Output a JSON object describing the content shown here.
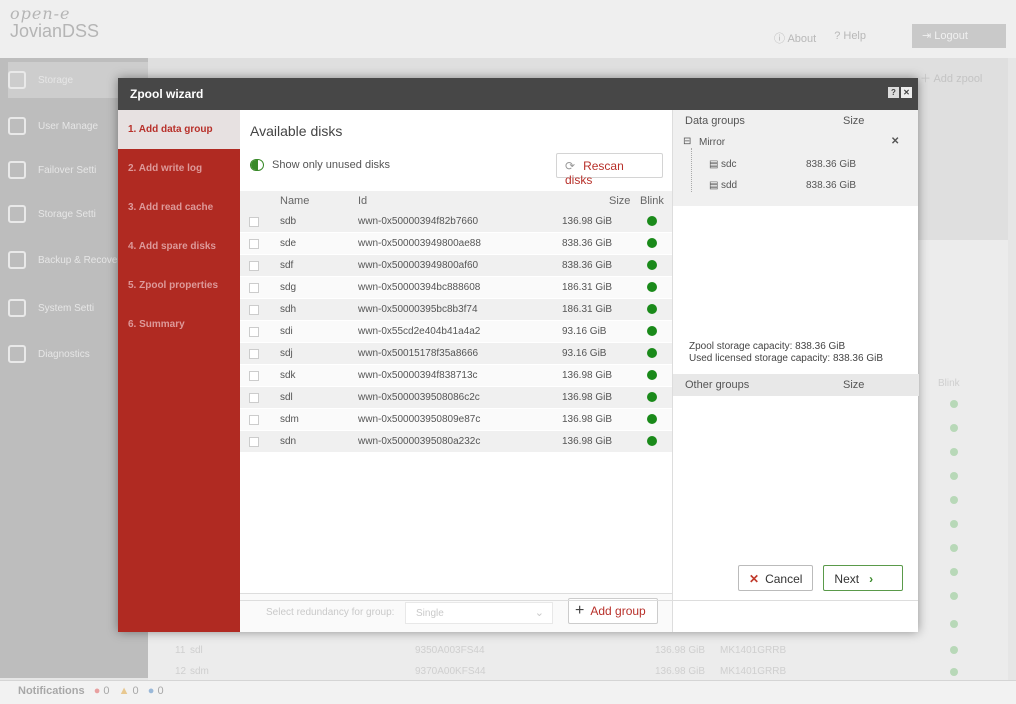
{
  "app": {
    "logo_top": "open-e",
    "logo_bottom": "JovianDSS",
    "about": "About",
    "help": "Help",
    "logout": "Logout",
    "add_zpool": "Add zpool"
  },
  "bg_nav": [
    "Storage",
    "User Manage",
    "Failover Setti",
    "Storage Setti",
    "Backup & Recovery",
    "System Setti",
    "Diagnostics"
  ],
  "bg_rows": {
    "blink_header": "Blink",
    "r11": [
      "11",
      "sdl",
      "9350A003FS44",
      "136.98 GiB",
      "MK1401GRRB"
    ],
    "r12": [
      "12",
      "sdm",
      "9370A00KFS44",
      "136.98 GiB",
      "MK1401GRRB"
    ]
  },
  "notifications": {
    "label": "Notifications",
    "errors": "0",
    "warnings": "0",
    "info": "0"
  },
  "dialog": {
    "title": "Zpool wizard",
    "steps": [
      "1. Add data group",
      "2. Add write log",
      "3. Add read cache",
      "4. Add spare disks",
      "5. Zpool properties",
      "6. Summary"
    ],
    "available_title": "Available disks",
    "toggle_label": "Show only unused disks",
    "rescan_label": "Rescan disks",
    "columns": {
      "name": "Name",
      "id": "Id",
      "size": "Size",
      "blink": "Blink"
    },
    "disks": [
      {
        "name": "sdb",
        "id": "wwn-0x50000394f82b7660",
        "size": "136.98 GiB"
      },
      {
        "name": "sde",
        "id": "wwn-0x500003949800ae88",
        "size": "838.36 GiB"
      },
      {
        "name": "sdf",
        "id": "wwn-0x500003949800af60",
        "size": "838.36 GiB"
      },
      {
        "name": "sdg",
        "id": "wwn-0x50000394bc888608",
        "size": "186.31 GiB"
      },
      {
        "name": "sdh",
        "id": "wwn-0x50000395bc8b3f74",
        "size": "186.31 GiB"
      },
      {
        "name": "sdi",
        "id": "wwn-0x55cd2e404b41a4a2",
        "size": "93.16 GiB"
      },
      {
        "name": "sdj",
        "id": "wwn-0x50015178f35a8666",
        "size": "93.16 GiB"
      },
      {
        "name": "sdk",
        "id": "wwn-0x50000394f838713c",
        "size": "136.98 GiB"
      },
      {
        "name": "sdl",
        "id": "wwn-0x5000039508086c2c",
        "size": "136.98 GiB"
      },
      {
        "name": "sdm",
        "id": "wwn-0x500003950809e87c",
        "size": "136.98 GiB"
      },
      {
        "name": "sdn",
        "id": "wwn-0x50000395080a232c",
        "size": "136.98 GiB"
      }
    ],
    "redundancy_label": "Select redundancy for group:",
    "redundancy_value": "Single",
    "add_group": "Add group",
    "data_groups_header": "Data groups",
    "size_header": "Size",
    "group_type": "Mirror",
    "group_members": [
      {
        "name": "sdc",
        "size": "838.36 GiB"
      },
      {
        "name": "sdd",
        "size": "838.36 GiB"
      }
    ],
    "capacity": "Zpool storage capacity: 838.36 GiB",
    "licensed": "Used licensed storage capacity: 838.36 GiB",
    "other_groups": "Other groups",
    "cancel": "Cancel",
    "next": "Next"
  }
}
